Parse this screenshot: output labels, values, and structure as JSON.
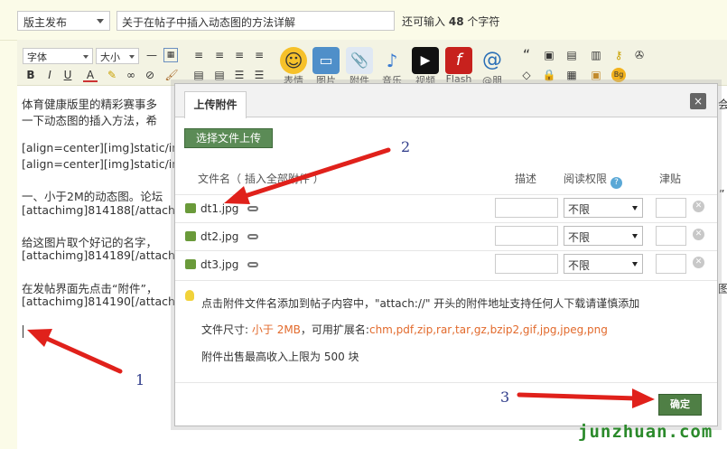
{
  "header": {
    "board_select": "版主发布",
    "title_value": "关于在帖子中插入动态图的方法详解",
    "remain_prefix": "还可输入",
    "remain_count": "48",
    "remain_suffix": "个字符"
  },
  "toolbar": {
    "font_select": "字体",
    "size_select": "大小",
    "big_buttons": [
      "表情",
      "图片",
      "附件",
      "音乐",
      "视频",
      "Flash",
      "@朋"
    ]
  },
  "editor": {
    "lines": [
      "体育健康版里的精彩赛事多",
      "一下动态图的插入方法，希",
      "[align=center][img]static/im",
      "[align=center][img]static/im",
      "一、小于2M的动态图。论坛",
      "[attachimg]814188[/attach",
      "给这图片取个好记的名字，",
      "[attachimg]814189[/attach",
      "在发帖界面先点击“附件”，",
      "[attachimg]814190[/attach"
    ],
    "right_fragments": [
      "会",
      "”",
      "图"
    ]
  },
  "dialog": {
    "tab_label": "上传附件",
    "close_glyph": "×",
    "upload_button": "选择文件上传",
    "columns": {
      "filename": "文件名（ 插入全部附件 ）",
      "description": "描述",
      "permission": "阅读权限",
      "price": "津贴"
    },
    "files": [
      {
        "name": "dt1.jpg",
        "permission": "不限"
      },
      {
        "name": "dt2.jpg",
        "permission": "不限"
      },
      {
        "name": "dt3.jpg",
        "permission": "不限"
      }
    ],
    "tips": {
      "line1": "点击附件文件名添加到帖子内容中，\"attach://\" 开头的附件地址支持任何人下载请谨慎添加",
      "size_label": "文件尺寸:",
      "size_value": "小于 2MB",
      "ext_label": "，可用扩展名:",
      "ext_value": "chm,pdf,zip,rar,tar,gz,bzip2,gif,jpg,jpeg,png",
      "line3": "附件出售最高收入上限为 500 块"
    },
    "confirm_button": "确定"
  },
  "annotations": {
    "n1": "1",
    "n2": "2",
    "n3": "3",
    "arrow_color": "#e0211b"
  },
  "watermark": "junzhuan.com"
}
